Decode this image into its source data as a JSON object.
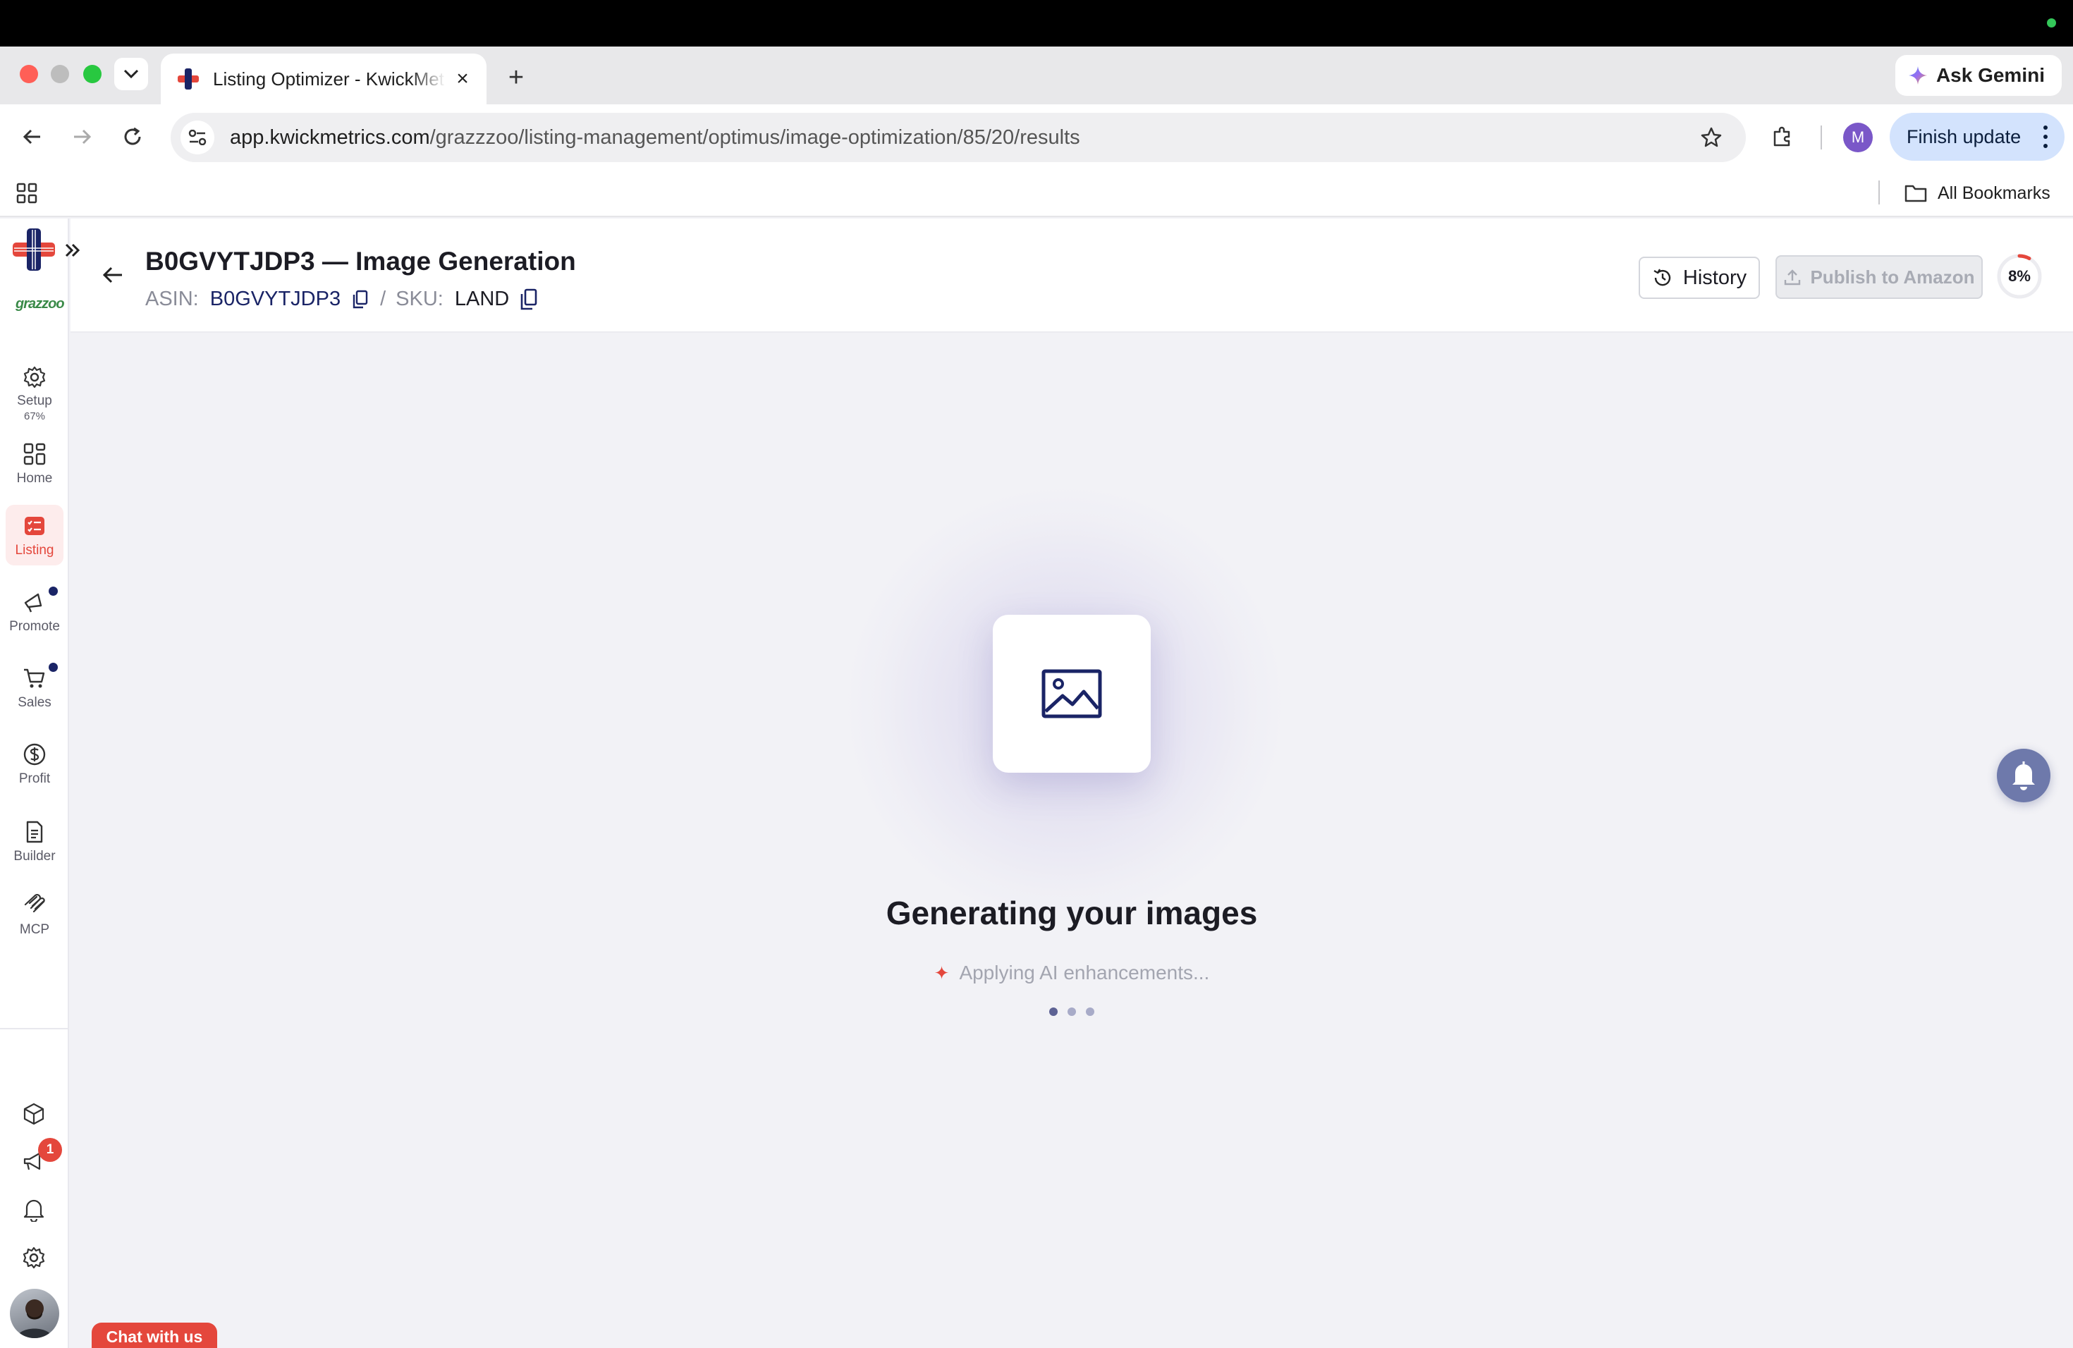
{
  "browser": {
    "tab_title": "Listing Optimizer - KwickMetrics",
    "new_tab_symbol": "+",
    "close_symbol": "×",
    "ask_gemini_label": "Ask Gemini",
    "url_host": "app.kwickmetrics.com",
    "url_path": "/grazzzoo/listing-management/optimus/image-optimization/85/20/results",
    "profile_initial": "M",
    "finish_update_label": "Finish update",
    "all_bookmarks_label": "All Bookmarks"
  },
  "sidebar": {
    "tenant_logo_text": "grazzoo",
    "items": [
      {
        "id": "setup",
        "label": "Setup",
        "sub": "67%",
        "icon": "gear-icon"
      },
      {
        "id": "home",
        "label": "Home",
        "icon": "grid-icon"
      },
      {
        "id": "listing",
        "label": "Listing",
        "icon": "listing-icon",
        "active": true
      },
      {
        "id": "promote",
        "label": "Promote",
        "icon": "megaphone-icon",
        "dot": true
      },
      {
        "id": "sales",
        "label": "Sales",
        "icon": "cart-icon",
        "dot": true
      },
      {
        "id": "profit",
        "label": "Profit",
        "icon": "dollar-icon"
      },
      {
        "id": "builder",
        "label": "Builder",
        "icon": "document-icon"
      },
      {
        "id": "mcp",
        "label": "MCP",
        "icon": "mcp-icon"
      }
    ],
    "announcements_badge": "1"
  },
  "header": {
    "title": "B0GVYTJDP3 — Image Generation",
    "asin_label": "ASIN:",
    "asin_value": "B0GVYTJDP3",
    "separator": "/",
    "sku_label": "SKU:",
    "sku_value": "LAND",
    "history_label": "History",
    "publish_label": "Publish to Amazon",
    "progress_text": "8%",
    "progress_value": 0.08
  },
  "main": {
    "title": "Generating your images",
    "subtitle": "Applying AI enhancements...",
    "spark_symbol": "✦",
    "chat_label": "Chat with us"
  },
  "colors": {
    "brand_red": "#e4473c",
    "brand_navy": "#1a2466",
    "bell_fab": "#6e79ab"
  }
}
